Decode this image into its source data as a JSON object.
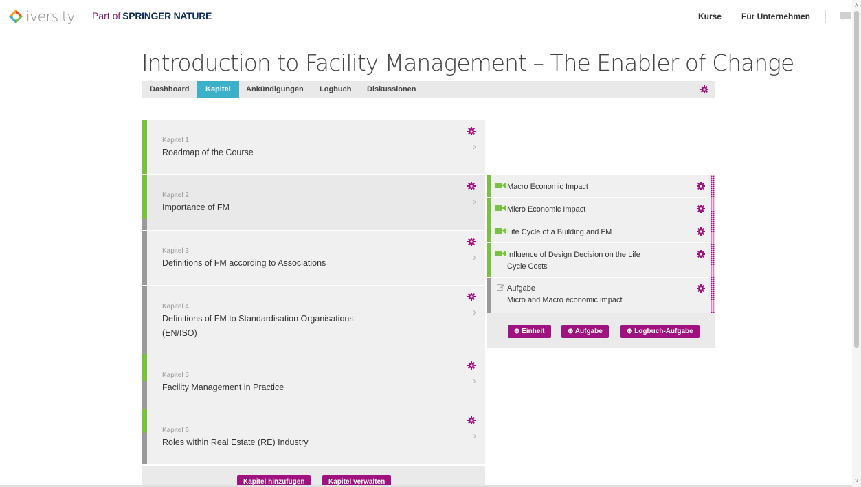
{
  "header": {
    "logo_text": "iversity",
    "part_of": "Part of",
    "springer": "SPRINGER NATURE",
    "nav": [
      "Kurse",
      "Für Unternehmen"
    ]
  },
  "course": {
    "title": "Introduction to Facility Management – The Enabler of Change"
  },
  "tabs": [
    {
      "label": "Dashboard",
      "active": false
    },
    {
      "label": "Kapitel",
      "active": true
    },
    {
      "label": "Ankündigungen",
      "active": false
    },
    {
      "label": "Logbuch",
      "active": false
    },
    {
      "label": "Diskussionen",
      "active": false
    }
  ],
  "chapters": [
    {
      "number": "Kapitel 1",
      "title": "Roadmap of the Course"
    },
    {
      "number": "Kapitel 2",
      "title": "Importance of FM"
    },
    {
      "number": "Kapitel 3",
      "title": "Definitions of FM according to Associations"
    },
    {
      "number": "Kapitel 4",
      "title": "Definitions of FM to Standardisation Organisations (EN/ISO)"
    },
    {
      "number": "Kapitel 5",
      "title": "Facility Management in Practice"
    },
    {
      "number": "Kapitel 6",
      "title": "Roles within Real Estate (RE) Industry"
    }
  ],
  "chapter_buttons": {
    "add": "Kapitel hinzufügen",
    "manage": "Kapitel verwalten"
  },
  "units": [
    {
      "type": "video",
      "title": "Macro Economic Impact"
    },
    {
      "type": "video",
      "title": "Micro Economic Impact"
    },
    {
      "type": "video",
      "title": "Life Cycle of a Building and FM"
    },
    {
      "type": "video",
      "title": "Influence of Design Decision on the Life Cycle Costs"
    },
    {
      "type": "task",
      "label": "Aufgabe",
      "title": "Micro and Macro economic impact"
    }
  ],
  "unit_buttons": {
    "unit": "Einheit",
    "task": "Aufgabe",
    "logbook_task": "Logbuch-Aufgabe"
  },
  "colors": {
    "accent_teal": "#3cb0c8",
    "action_purple": "#a0127f",
    "stripe_green": "#7ac143",
    "stripe_gray": "#9a9a9a"
  },
  "icons": {
    "settings": "gear-icon",
    "chevron": "chevron-right-icon",
    "video": "video-camera-icon",
    "task": "edit-icon",
    "add": "plus-circle-icon",
    "chat": "chat-icon"
  }
}
